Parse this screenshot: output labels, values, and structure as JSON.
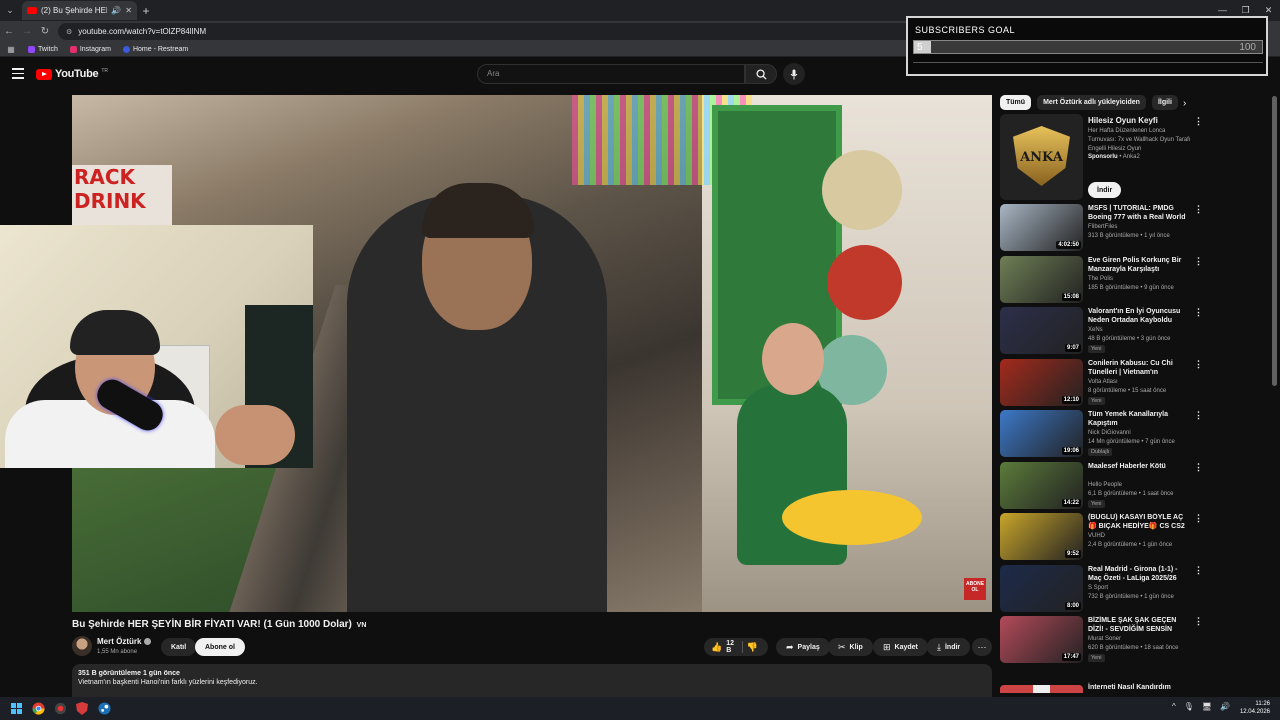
{
  "browser": {
    "tab_title": "(2) Bu Şehirde HER ŞEYİN B...",
    "url": "youtube.com/watch?v=tOlZP84lINM",
    "bookmarks": [
      {
        "label": "Twitch",
        "color": "#9146ff"
      },
      {
        "label": "Instagram",
        "color": "#e1306c"
      },
      {
        "label": "Home - Restream",
        "color": "#3b5bdb"
      }
    ],
    "window_controls": [
      "—",
      "❐",
      "✕"
    ]
  },
  "header": {
    "logo_text": "YouTube",
    "logo_country": "TR",
    "search_placeholder": "Ara"
  },
  "overlay": {
    "goal_title": "SUBSCRIBERS GOAL",
    "goal_current": "5",
    "goal_max": "100",
    "goal_progress": 0.05
  },
  "player": {
    "sign_line1": "RACK",
    "sign_line2": "DRINK",
    "badge_text": "ABONE OL"
  },
  "video": {
    "title": "Bu Şehirde HER ŞEYİN BİR FİYATI VAR! (1 Gün 1000 Dolar)",
    "title_suffix": "VN",
    "channel_name": "Mert Öztürk",
    "subscribers": "1,55 Mn abone",
    "join_label": "Katıl",
    "subscribe_label": "Abone ol",
    "like_count": "12 B",
    "share_label": "Paylaş",
    "clip_label": "Klip",
    "save_label": "Kaydet",
    "download_label": "İndir",
    "views_time": "351 B görüntüleme  1 gün önce",
    "description": "Vietnam'ın başkenti Hanoi'nin farklı yüzlerini keşfediyoruz."
  },
  "sidebar": {
    "chips": [
      "Tümü",
      "Mert Öztürk adlı yükleyiciden",
      "İlgili"
    ],
    "ad": {
      "title": "Hilesiz Oyun Keyfi",
      "description": "Her Hafta Düzenlenen Lonca Turnuvası: 7x ve Wallhack Oyun Tarafı Engelli Hilesiz Oyun",
      "sponsor_label": "Sponsorlu",
      "sponsor_name": "Anka2",
      "thumb_text": "ANKA",
      "button_label": "İndir"
    },
    "videos": [
      {
        "title": "MSFS | TUTORIAL: PMDG Boeing 777 with a Real World ...",
        "channel": "FlibertFiles",
        "meta": "313 B görüntüleme • 1 yıl önce",
        "duration": "4:02:50",
        "badge": "",
        "thumb_color": "#a8b6c4"
      },
      {
        "title": "Eve Giren Polis Korkunç Bir Manzarayla Karşılaştı",
        "channel": "The Polis",
        "meta": "185 B görüntüleme • 9 gün önce",
        "duration": "15:08",
        "badge": "",
        "thumb_color": "#6e7f55"
      },
      {
        "title": "Valorant'ın En İyi Oyuncusu Neden Ortadan Kayboldu",
        "channel": "XeNs",
        "meta": "48 B görüntüleme • 3 gün önce",
        "duration": "9:07",
        "badge": "Yeni",
        "thumb_color": "#2b2f4a"
      },
      {
        "title": "Conilerin Kabusu: Cu Chi Tünelleri | Vietnam'ın Görünme...",
        "channel": "Volta Atlası",
        "meta": "8 görüntüleme • 15 saat önce",
        "duration": "12:10",
        "badge": "Yeni",
        "thumb_color": "#a42a1c"
      },
      {
        "title": "Tüm Yemek Kanallarıyla Kapıştım",
        "channel": "Nick DiGiovanni",
        "meta": "14 Mn görüntüleme • 7 gün önce",
        "duration": "19:06",
        "badge": "Dublajlı",
        "thumb_color": "#3c78c8"
      },
      {
        "title": "Maalesef Haberler Kötü",
        "channel": "Hello People",
        "meta": "6,1 B görüntüleme • 1 saat önce",
        "duration": "14:22",
        "badge": "Yeni",
        "thumb_color": "#5b7b3a"
      },
      {
        "title": "(BUGLU) KASAYI BÖYLE AÇ 🎁 BIÇAK HEDİYE🎁 CS CS2 ...",
        "channel": "VUHD",
        "meta": "2,4 B görüntüleme • 1 gün önce",
        "duration": "9:52",
        "badge": "",
        "thumb_color": "#c8a52a"
      },
      {
        "title": "Real Madrid - Girona (1-1) - Maç Özeti - LaLiga 2025/26",
        "channel": "S Sport",
        "meta": "732 B görüntüleme • 1 gün önce",
        "duration": "8:00",
        "badge": "",
        "thumb_color": "#1d2a4a"
      },
      {
        "title": "BİZİMLE ŞAK ŞAK GEÇEN DİZİ! - SEVDİĞİM SENSİN ELEŞTİRİSİ",
        "channel": "Murat Soner",
        "meta": "620 B görüntüleme • 18 saat önce",
        "duration": "17:47",
        "badge": "Yeni",
        "thumb_color": "#b44a5a"
      }
    ],
    "last_title": "İnterneti Nasıl Kandırdım"
  },
  "taskbar": {
    "time": "11:26",
    "date": "12.04.2026"
  }
}
